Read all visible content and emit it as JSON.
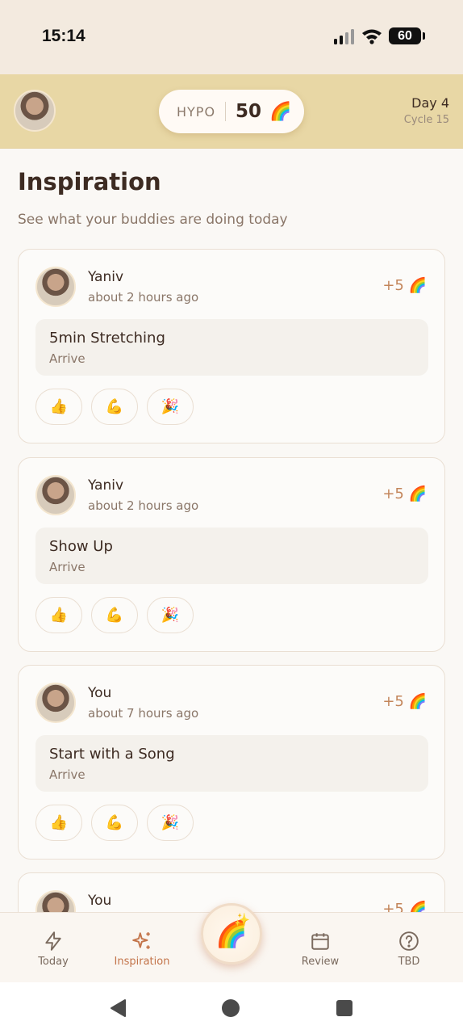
{
  "status_bar": {
    "time": "15:14",
    "battery": "60"
  },
  "header": {
    "score_label": "HYPO",
    "score_value": "50",
    "score_emoji": "🌈",
    "day": "Day 4",
    "cycle": "Cycle 15"
  },
  "page": {
    "title": "Inspiration",
    "subtitle": "See what your buddies are doing today"
  },
  "feed": [
    {
      "name": "Yaniv",
      "time": "about 2 hours ago",
      "points": "+5 🌈",
      "activity": "5min Stretching",
      "stage": "Arrive"
    },
    {
      "name": "Yaniv",
      "time": "about 2 hours ago",
      "points": "+5 🌈",
      "activity": "Show Up",
      "stage": "Arrive"
    },
    {
      "name": "You",
      "time": "about 7 hours ago",
      "points": "+5 🌈",
      "activity": "Start with a Song",
      "stage": "Arrive"
    },
    {
      "name": "You",
      "time": "",
      "points": "+5 🌈",
      "activity": "",
      "stage": ""
    }
  ],
  "reactions": [
    "👍",
    "💪",
    "🎉"
  ],
  "nav": {
    "today": "Today",
    "inspiration": "Inspiration",
    "fab_emoji": "🌈",
    "fab_sparkle": "✨",
    "review": "Review",
    "tbd": "TBD"
  },
  "colors": {
    "accent": "#c3744a",
    "header_bg": "#e8d7a5",
    "status_bg": "#f3eadf"
  }
}
